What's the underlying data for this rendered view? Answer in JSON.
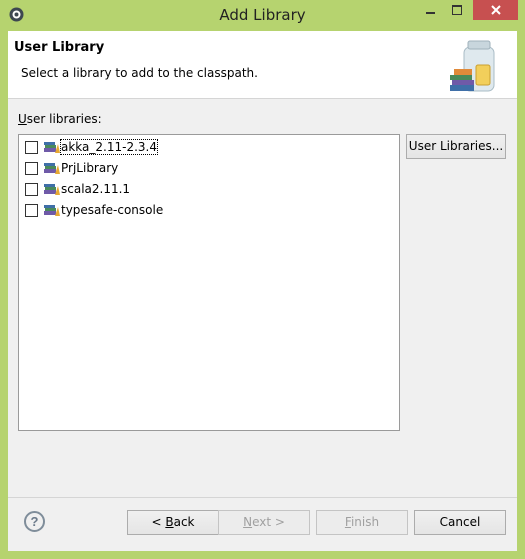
{
  "window": {
    "title": "Add Library",
    "icons": {
      "app": "eclipse-gear-icon",
      "minimize": "minimize-icon",
      "maximize": "maximize-icon",
      "close": "close-icon"
    },
    "close_color": "#c75050",
    "frame_color": "#b6d36f"
  },
  "header": {
    "title": "User Library",
    "description": "Select a library to add to the classpath.",
    "art_icon": "library-jar-icon"
  },
  "libraries": {
    "label_mnemonic": "U",
    "label_rest": "ser libraries:",
    "items": [
      {
        "label": "akka_2.11-2.3.4",
        "checked": false,
        "focused": true,
        "icon": "library-icon"
      },
      {
        "label": "PrjLibrary",
        "checked": false,
        "focused": false,
        "icon": "library-icon"
      },
      {
        "label": "scala2.11.1",
        "checked": false,
        "focused": false,
        "icon": "library-icon"
      },
      {
        "label": "typesafe-console",
        "checked": false,
        "focused": false,
        "icon": "library-icon"
      }
    ],
    "user_libraries_button": "User Libraries..."
  },
  "footer": {
    "help_icon": "help-icon",
    "back_prefix": "< ",
    "back_mnemonic": "B",
    "back_rest": "ack",
    "next_mnemonic": "N",
    "next_rest": "ext >",
    "finish_mnemonic": "F",
    "finish_rest": "inish",
    "cancel": "Cancel"
  }
}
